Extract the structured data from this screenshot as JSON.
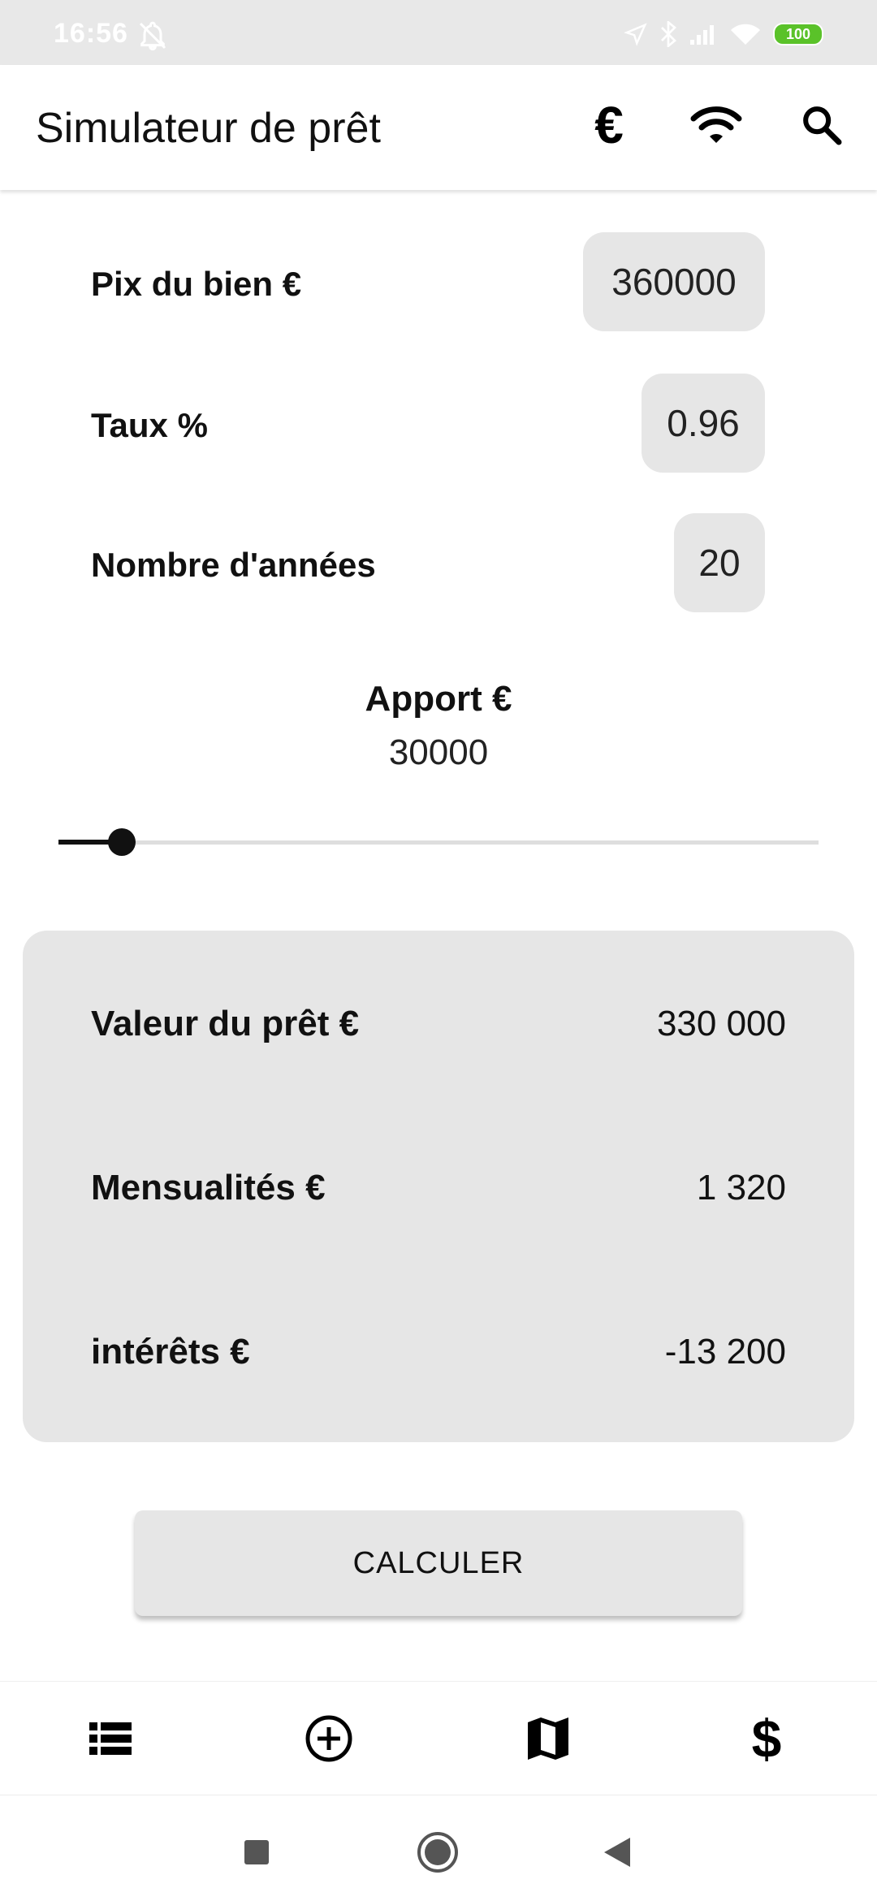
{
  "status_bar": {
    "time": "16:56",
    "battery": "100"
  },
  "app_bar": {
    "title": "Simulateur de prêt",
    "currency_icon": "€"
  },
  "form": {
    "price": {
      "label": "Pix du bien €",
      "value": "360000"
    },
    "rate": {
      "label": "Taux %",
      "value": "0.96"
    },
    "years": {
      "label": "Nombre d'années",
      "value": "20"
    },
    "apport": {
      "label": "Apport €",
      "value": "30000",
      "slider_fraction": 0.083
    }
  },
  "results": {
    "loan": {
      "label": "Valeur du prêt €",
      "value": "330 000"
    },
    "monthly": {
      "label": "Mensualités €",
      "value": "1 320"
    },
    "interest": {
      "label": "intérêts €",
      "value": "-13 200"
    }
  },
  "calculate_button": {
    "label": "CALCULER"
  },
  "bottom_nav": {
    "items": [
      "list-icon",
      "add-circle-icon",
      "map-icon",
      "dollar-icon"
    ],
    "dollar_symbol": "$"
  },
  "system_nav": {
    "items": [
      "recents-square-icon",
      "home-circle-icon",
      "back-triangle-icon"
    ]
  },
  "colors": {
    "field_background": "#e6e6e6",
    "battery": "#5ac229",
    "status_bar": "#e8e8e8"
  }
}
